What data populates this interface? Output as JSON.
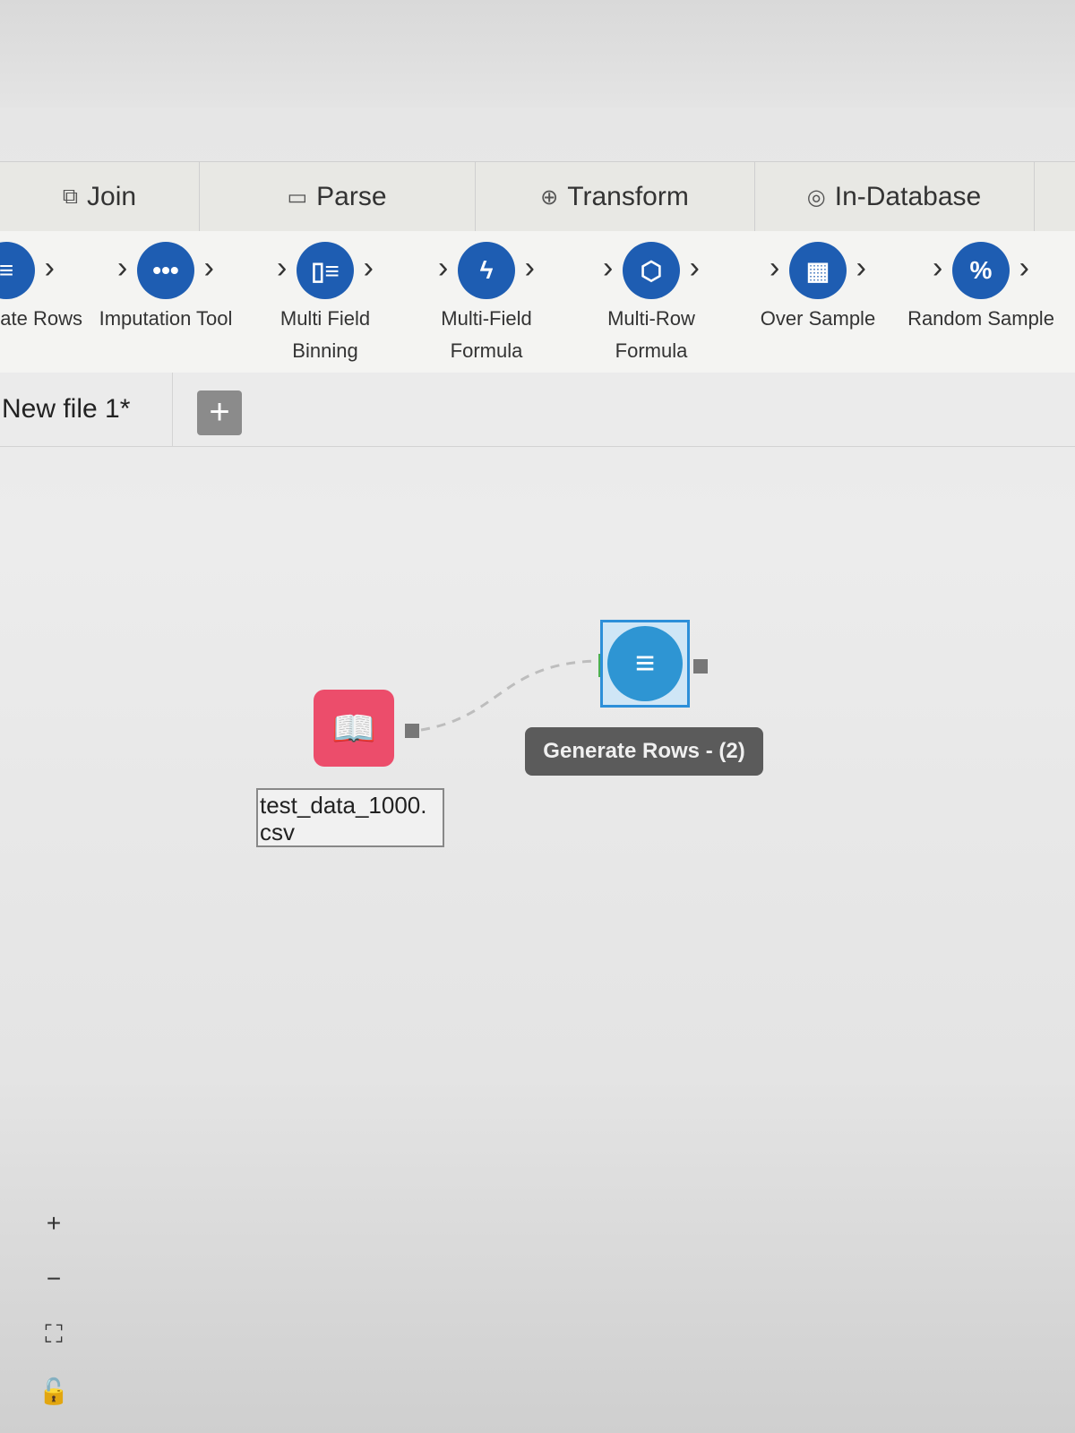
{
  "categories": [
    {
      "icon": "join-icon",
      "label": "Join"
    },
    {
      "icon": "parse-icon",
      "label": "Parse"
    },
    {
      "icon": "transform-icon",
      "label": "Transform"
    },
    {
      "icon": "in-database-icon",
      "label": "In-Database"
    }
  ],
  "tools": [
    {
      "icon": "generate-rows-icon",
      "label": "ate Rows"
    },
    {
      "icon": "imputation-icon",
      "label": "Imputation Tool"
    },
    {
      "icon": "multi-field-binning-icon",
      "label": "Multi Field\nBinning"
    },
    {
      "icon": "multi-field-formula-icon",
      "label": "Multi-Field\nFormula"
    },
    {
      "icon": "multi-row-formula-icon",
      "label": "Multi-Row\nFormula"
    },
    {
      "icon": "over-sample-icon",
      "label": "Over Sample"
    },
    {
      "icon": "random-sample-icon",
      "label": "Random Sample"
    }
  ],
  "file_tab": {
    "label": "New file 1*",
    "add_label": "+"
  },
  "canvas": {
    "input_node_label": "test_data_1000.\ncsv",
    "generate_rows_label": "Generate Rows - (2)"
  },
  "zoom_controls": {
    "zoom_in": "+",
    "zoom_out": "−"
  }
}
